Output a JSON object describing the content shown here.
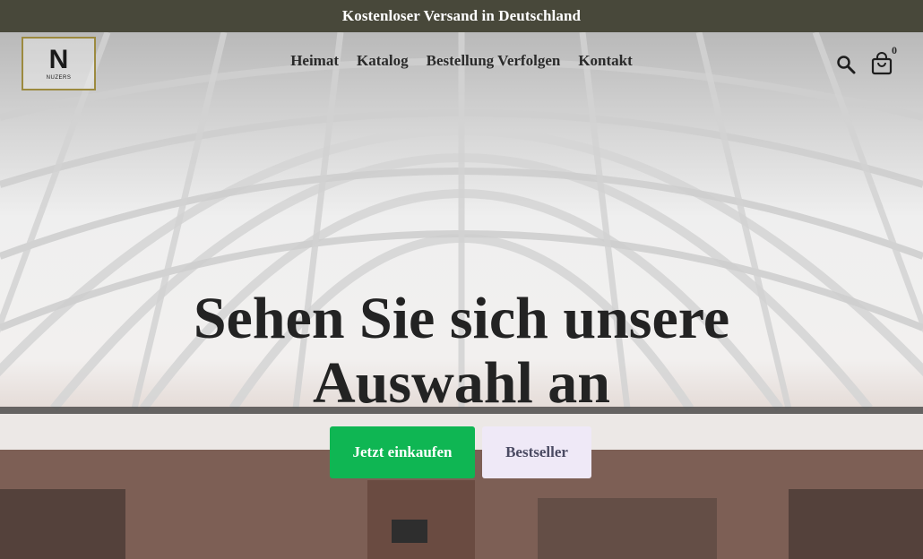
{
  "announcement": {
    "text": "Kostenloser Versand in Deutschland"
  },
  "logo": {
    "letter": "N",
    "subtext": "NUZERS"
  },
  "nav": {
    "items": [
      {
        "label": "Heimat"
      },
      {
        "label": "Katalog"
      },
      {
        "label": "Bestellung Verfolgen"
      },
      {
        "label": "Kontakt"
      }
    ]
  },
  "header_icons": {
    "search": "search-icon",
    "cart": "shopping-bag-icon",
    "cart_count": "0"
  },
  "hero": {
    "headline": "Sehen Sie sich unsere Auswahl an",
    "primary_button": "Jetzt einkaufen",
    "secondary_button": "Bestseller"
  },
  "colors": {
    "announcement_bg": "#48483a",
    "primary_button": "#0fb653",
    "secondary_button": "#efe9f7",
    "logo_border": "#9c8a3f"
  }
}
